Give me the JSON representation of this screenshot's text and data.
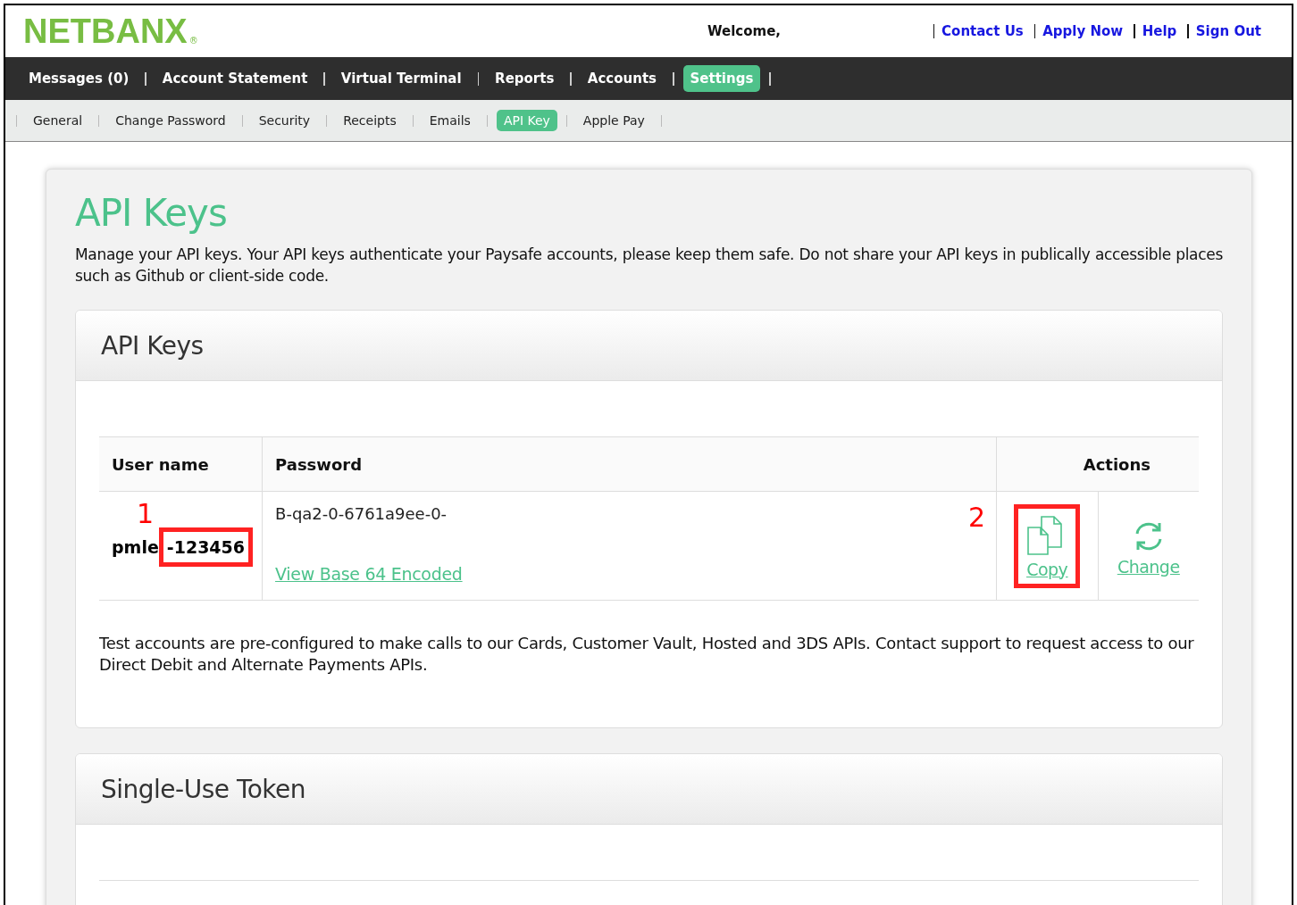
{
  "header": {
    "logo": "NETBANX",
    "logo_mark": "®",
    "welcome": "Welcome,",
    "links": [
      "Contact Us",
      "Apply Now",
      "Help",
      "Sign Out"
    ]
  },
  "main_nav": [
    {
      "label": "Messages (0)",
      "selected": false
    },
    {
      "label": "Account Statement",
      "selected": false
    },
    {
      "label": "Virtual Terminal",
      "selected": false
    },
    {
      "label": "Reports",
      "selected": false
    },
    {
      "label": "Accounts",
      "selected": false
    },
    {
      "label": "Settings",
      "selected": true
    }
  ],
  "sub_nav": [
    {
      "label": "General",
      "selected": false
    },
    {
      "label": "Change Password",
      "selected": false
    },
    {
      "label": "Security",
      "selected": false
    },
    {
      "label": "Receipts",
      "selected": false
    },
    {
      "label": "Emails",
      "selected": false
    },
    {
      "label": "API Key",
      "selected": true
    },
    {
      "label": "Apple Pay",
      "selected": false
    }
  ],
  "page": {
    "title": "API Keys",
    "description": "Manage your API keys. Your API keys authenticate your Paysafe accounts, please keep them safe. Do not share your API keys in publically accessible places such as Github or client-side code."
  },
  "api_keys_panel": {
    "title": "API Keys",
    "columns": [
      "User name",
      "Password",
      "Actions"
    ],
    "rows": [
      {
        "marker": "1",
        "user_name": "pmle",
        "user_name_suffix": "-123456",
        "suffix_highlighted": true,
        "password": "B-qa2-0-6761a9ee-0-",
        "link": "View Base 64 Encoded",
        "action_marker": "2",
        "actions": [
          {
            "kind": "copy",
            "label": "Copy",
            "highlighted": true
          },
          {
            "kind": "change",
            "label": "Change",
            "highlighted": false
          }
        ]
      }
    ],
    "note": "Test accounts are pre-configured to make calls to our Cards, Customer Vault, Hosted and 3DS APIs. Contact support to request access to our Direct Debit and Alternate Payments APIs."
  },
  "token_panel": {
    "title": "Single-Use Token"
  }
}
